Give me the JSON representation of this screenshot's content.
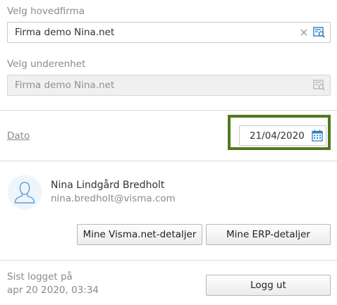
{
  "company": {
    "main_label": "Velg hovedfirma",
    "main_value": "Firma demo Nina.net",
    "sub_label": "Velg underenhet",
    "sub_value": "Firma demo Nina.net"
  },
  "date": {
    "label": "Dato",
    "value": "21/04/2020"
  },
  "user": {
    "name": "Nina Lindgård Bredholt",
    "email": "nina.bredholt@visma.com",
    "btn_visma": "Mine Visma.net-detaljer",
    "btn_erp": "Mine ERP-detaljer"
  },
  "session": {
    "last_login_label": "Sist logget på",
    "last_login_value": "apr 20 2020, 03:34",
    "logout_label": "Logg ut"
  },
  "colors": {
    "accent_blue": "#2f7fc1",
    "highlight_green": "#4f7a1f"
  },
  "icons": {
    "clear": "close-icon",
    "lookup": "search-list-icon",
    "calendar": "calendar-icon",
    "avatar": "user-avatar-icon"
  }
}
